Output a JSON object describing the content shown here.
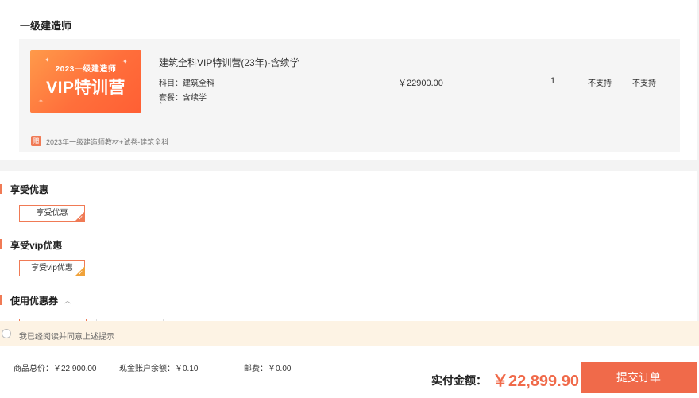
{
  "order": {
    "section_title": "一级建造师",
    "product": {
      "thumb_line1": "2023一级建造师",
      "thumb_line2": "VIP特训营",
      "title": "建筑全科VIP特训营(23年)-含续学",
      "subject_label": "科目：",
      "subject_value": "建筑全科",
      "package_label": "套餐：",
      "package_value": "含续学",
      "tick": "`",
      "price": "￥22900.00",
      "quantity": "1",
      "col_a": "不支持",
      "col_b": "不支持",
      "gift_icon": "gift-icon",
      "gift": "2023年一级建造师教材+试卷-建筑全科"
    }
  },
  "discounts": {
    "enjoy_title": "享受优惠",
    "enjoy_button": "享受优惠",
    "vip_title": "享受vip优惠",
    "vip_button": "享受vip优惠",
    "coupon_title": "使用优惠券",
    "coupon_chevron": "︿"
  },
  "agreement": {
    "text": "我已经阅读并同意上述提示"
  },
  "footer": {
    "total_label": "商品总价：",
    "total_value": "￥22,900.00",
    "balance_label": "现金账户余额：",
    "balance_value": "￥0.10",
    "shipping_label": "邮费：",
    "shipping_value": "￥0.00",
    "pay_label": "实付金额：",
    "pay_amount": "￥22,899.90",
    "submit": "提交订单"
  },
  "colors": {
    "accent": "#f06a4a",
    "agree_bg": "#fdf3e4"
  }
}
